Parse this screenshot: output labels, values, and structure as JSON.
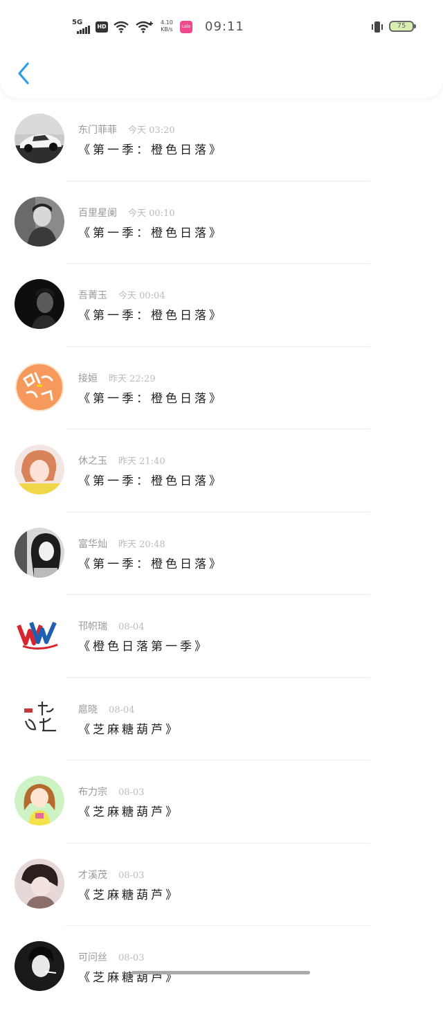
{
  "status_bar": {
    "network": "5G",
    "hd": "HD",
    "speed_value": "4.10",
    "speed_unit": "KB/s",
    "app_badge": "Lolo",
    "time": "09:11",
    "battery": "75"
  },
  "colors": {
    "accent": "#2a9ee8",
    "battery_fill": "#d9efb0"
  },
  "header": {
    "back_icon": "chevron-left-icon"
  },
  "messages": [
    {
      "name": "东门菲菲",
      "time": "今天 03:20",
      "title": "《第一季：橙色日落》"
    },
    {
      "name": "百里星阑",
      "time": "今天 00:10",
      "title": "《第一季：橙色日落》"
    },
    {
      "name": "吾菁玉",
      "time": "今天 00:04",
      "title": "《第一季：橙色日落》"
    },
    {
      "name": "接姮",
      "time": "昨天 22:29",
      "title": "《第一季：橙色日落》"
    },
    {
      "name": "休之玉",
      "time": "昨天 21:40",
      "title": "《第一季：橙色日落》"
    },
    {
      "name": "富华灿",
      "time": "昨天 20:48",
      "title": "《第一季：橙色日落》"
    },
    {
      "name": "邗帜瑞",
      "time": "08-04",
      "title": "《橙色日落第一季》"
    },
    {
      "name": "扈晓",
      "time": "08-04",
      "title": "《芝麻糖葫芦》"
    },
    {
      "name": "布力宗",
      "time": "08-03",
      "title": "《芝麻糖葫芦》"
    },
    {
      "name": "才溪茂",
      "time": "08-03",
      "title": "《芝麻糖葫芦》"
    },
    {
      "name": "可问丝",
      "time": "08-03",
      "title": "《芝麻糖葫芦》"
    }
  ]
}
